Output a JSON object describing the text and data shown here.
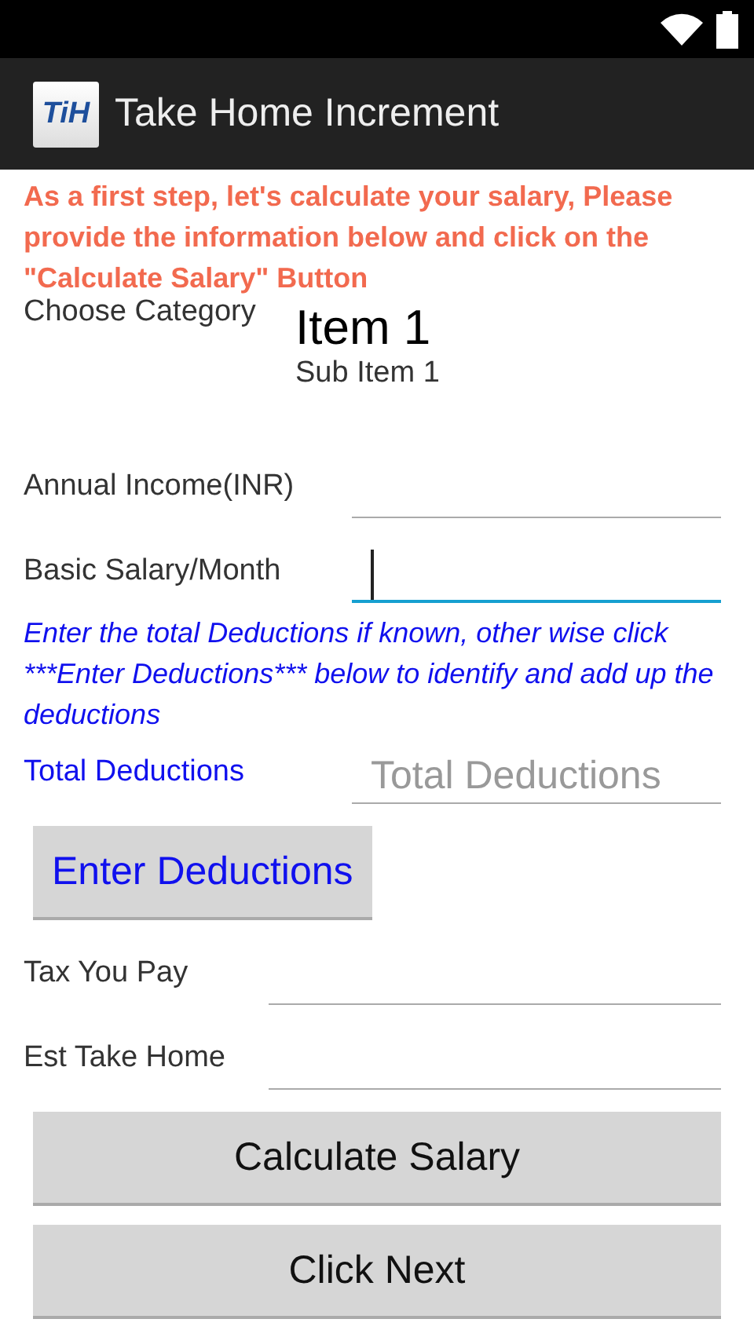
{
  "app_bar": {
    "logo": "TiH",
    "title": "Take Home Increment"
  },
  "intro": "As a first step, let's calculate your salary, Please provide the information below and click on the \"Calculate Salary\" Button",
  "category": {
    "label": "Choose Category",
    "item": "Item 1",
    "sub_item": "Sub Item 1"
  },
  "fields_top": [
    {
      "label": "Annual Income(INR)",
      "focused": false
    },
    {
      "label": "Basic Salary/Month",
      "focused": true
    }
  ],
  "hint": "Enter the total Deductions if known, other wise click ***Enter Deductions*** below to identify and add up the deductions",
  "deductions": {
    "label": "Total Deductions",
    "placeholder": "Total Deductions",
    "button": "Enter Deductions"
  },
  "fields_bottom": [
    {
      "label": "Tax You Pay",
      "focused": false
    },
    {
      "label": "Est Take Home",
      "focused": false
    }
  ],
  "buttons": [
    "Calculate Salary",
    "Click Next"
  ]
}
